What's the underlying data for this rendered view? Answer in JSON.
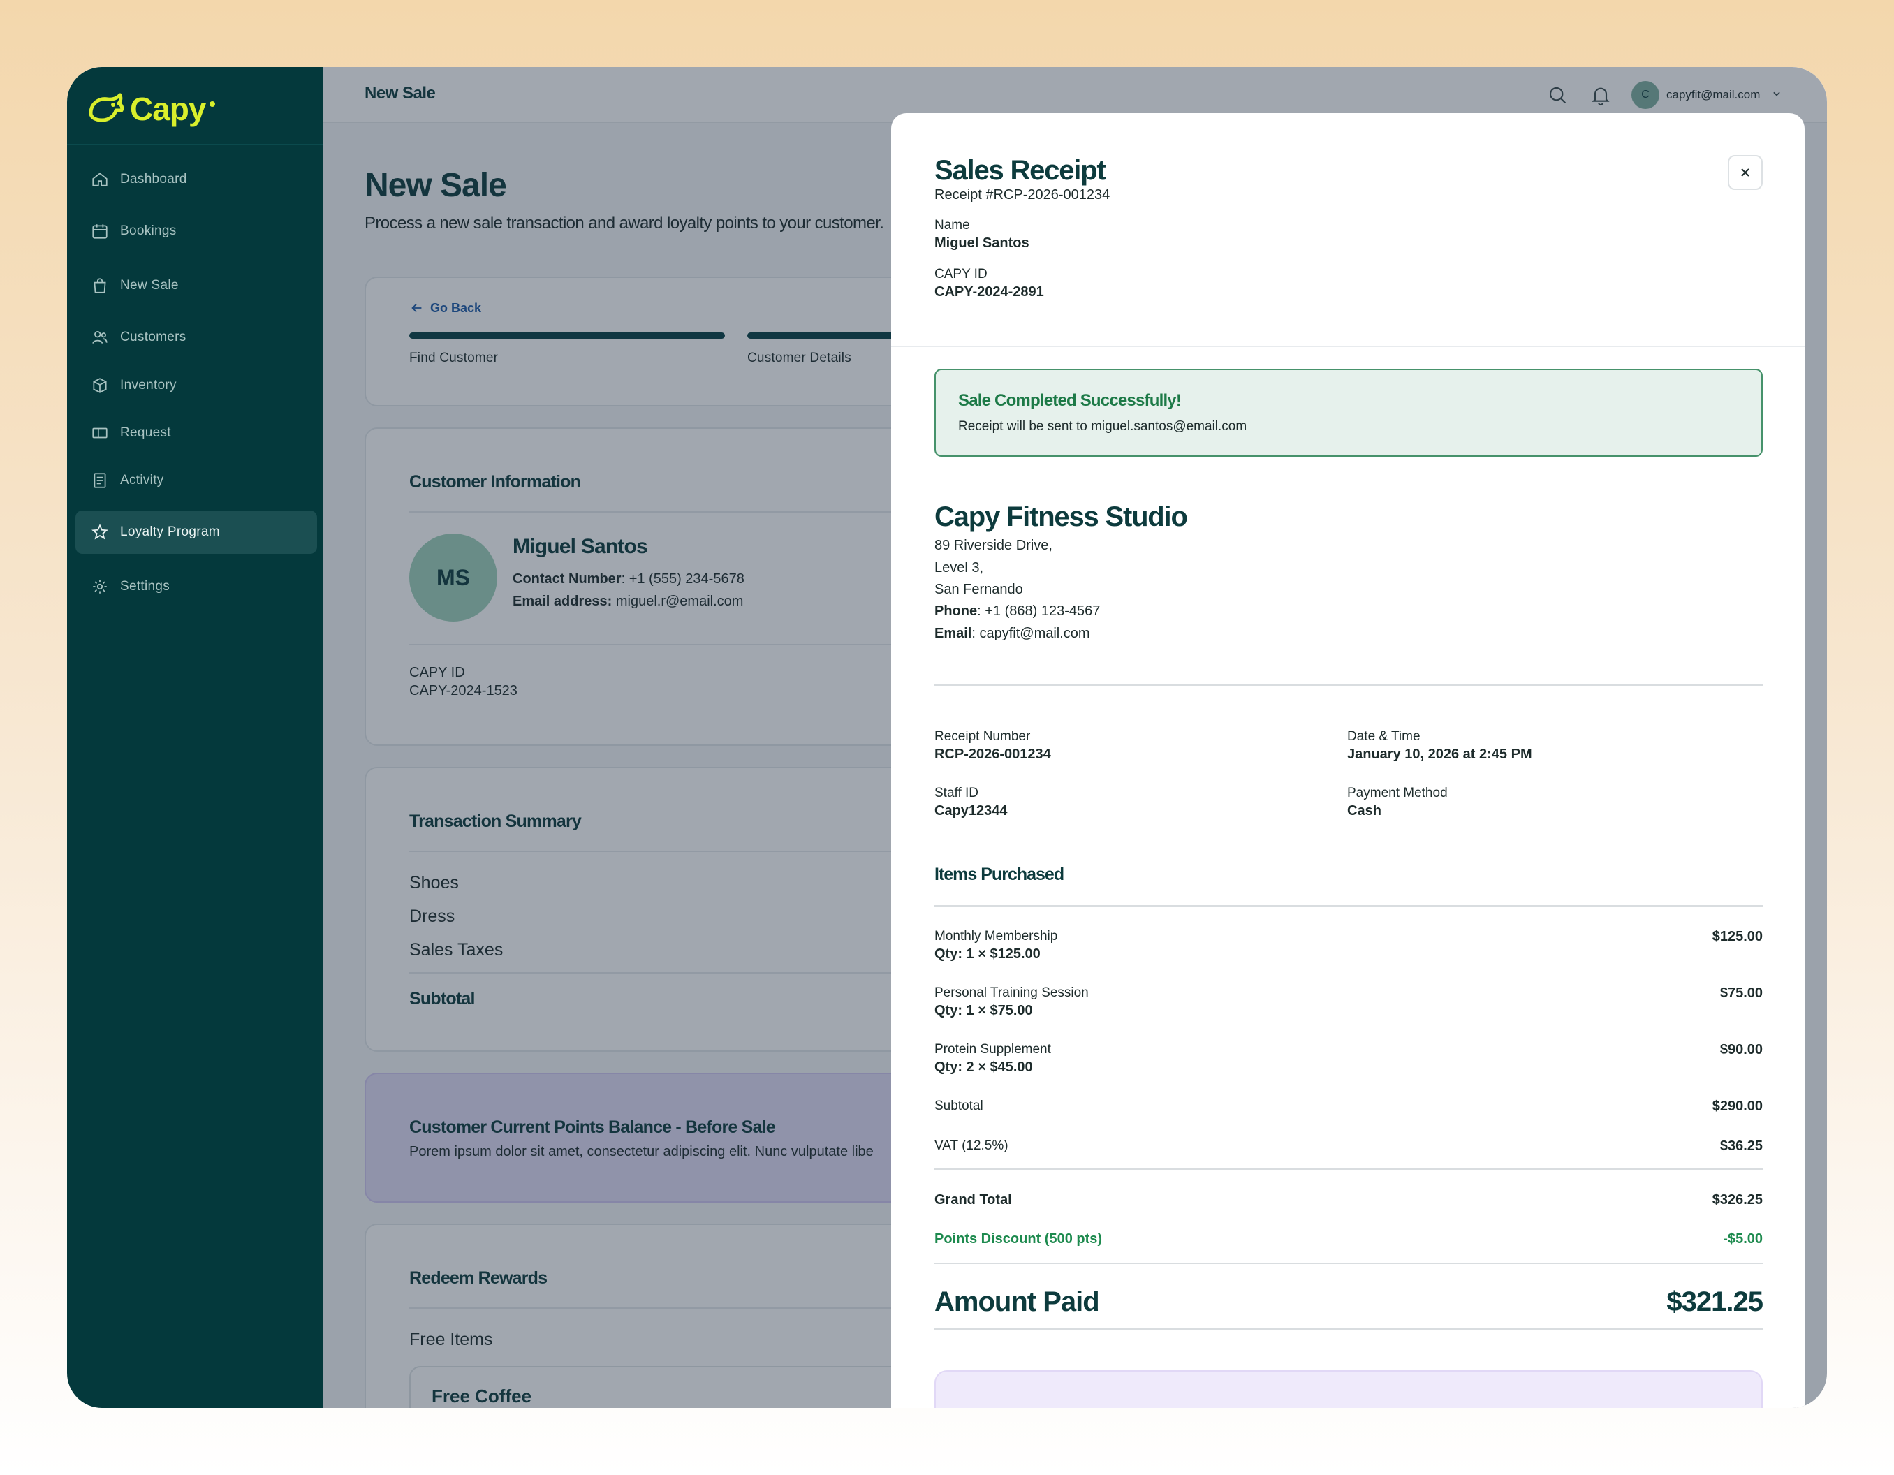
{
  "app": {
    "brand": "Capy"
  },
  "sidebar": {
    "items": [
      {
        "label": "Dashboard",
        "icon": "home-icon"
      },
      {
        "label": "Bookings",
        "icon": "calendar-icon"
      },
      {
        "label": "New Sale",
        "icon": "shopping-bag-icon"
      },
      {
        "label": "Customers",
        "icon": "users-icon"
      },
      {
        "label": "Inventory",
        "icon": "box-icon"
      },
      {
        "label": "Request",
        "icon": "ticket-icon"
      },
      {
        "label": "Activity",
        "icon": "clipboard-icon"
      },
      {
        "label": "Loyalty Program",
        "icon": "star-icon",
        "active": true
      },
      {
        "label": "Settings",
        "icon": "gear-icon"
      }
    ]
  },
  "topbar": {
    "title": "New Sale",
    "user_initial": "C",
    "user_email": "capyfit@mail.com"
  },
  "page": {
    "title": "New Sale",
    "subtitle": "Process a new sale transaction and award loyalty points to your customer.",
    "go_back": "Go Back",
    "steps": [
      "Find Customer",
      "Customer Details"
    ]
  },
  "customer_card": {
    "title": "Customer Information",
    "initials": "MS",
    "name": "Miguel Santos",
    "contact_label": "Contact Number",
    "contact_value": ": +1 (555) 234-5678",
    "email_label": "Email address:",
    "email_value": " miguel.r@email.com",
    "capy_id_label": "CAPY ID",
    "capy_id_value": "CAPY-2024-1523"
  },
  "transaction_card": {
    "title": "Transaction Summary",
    "items": [
      "Shoes",
      "Dress",
      "Sales Taxes"
    ],
    "subtotal_label": "Subtotal"
  },
  "points_card": {
    "title": "Customer Current Points Balance - Before Sale",
    "text": "Porem ipsum dolor sit amet, consectetur adipiscing elit. Nunc vulputate libe"
  },
  "rewards_card": {
    "title": "Redeem Rewards",
    "subtitle": "Free Items",
    "item": "Free Coffee"
  },
  "receipt": {
    "title": "Sales Receipt",
    "number_header": "Receipt #RCP-2026-001234",
    "name_label": "Name",
    "name_value": "Miguel Santos",
    "capy_id_label": "CAPY ID",
    "capy_id_value": "CAPY-2024-2891",
    "success_title": "Sale Completed Successfully!",
    "success_text": "Receipt will be sent to miguel.santos@email.com",
    "business_name": "Capy Fitness Studio",
    "address_lines": [
      "89 Riverside Drive,",
      "Level 3,",
      "San Fernando"
    ],
    "phone_label": "Phone",
    "phone_value": ": +1 (868) 123-4567",
    "email_label": "Email",
    "email_value": ": capyfit@mail.com",
    "receipt_number_label": "Receipt Number",
    "receipt_number_value": "RCP-2026-001234",
    "date_label": "Date & Time",
    "date_value": "January 10, 2026 at 2:45 PM",
    "staff_label": "Staff ID",
    "staff_value": "Capy12344",
    "payment_label": "Payment Method",
    "payment_value": "Cash",
    "items_title": "Items Purchased",
    "items": [
      {
        "name": "Monthly Membership",
        "qty": "Qty: 1 × $125.00",
        "amount": "$125.00"
      },
      {
        "name": "Personal Training Session",
        "qty": "Qty: 1 × $75.00",
        "amount": "$75.00"
      },
      {
        "name": "Protein Supplement",
        "qty": "Qty: 2 × $45.00",
        "amount": "$90.00"
      }
    ],
    "subtotal_label": "Subtotal",
    "subtotal_value": "$290.00",
    "vat_label": "VAT (12.5%)",
    "vat_value": "$36.25",
    "grand_total_label": "Grand Total",
    "grand_total_value": "$326.25",
    "discount_label": "Points Discount (500 pts)",
    "discount_value": "-$5.00",
    "amount_paid_label": "Amount Paid",
    "amount_paid_value": "$321.25"
  },
  "colors": {
    "sidebar_bg": "#04393c",
    "brand_yellow": "#d9ef2c",
    "success_green": "#1d8a4e",
    "primary_dark": "#0d3b3d"
  }
}
